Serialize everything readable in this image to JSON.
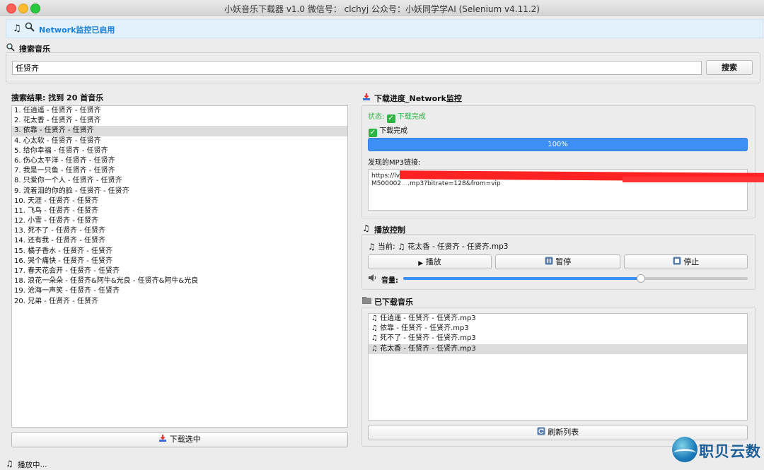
{
  "window": {
    "title": "小妖音乐下载器 v1.0  微信号： clchyj 公众号：小妖同学学AI (Selenium v4.11.2)"
  },
  "network_banner": {
    "text": "Network监控已启用"
  },
  "search": {
    "section_title": "搜索音乐",
    "input_value": "任贤齐",
    "button_label": "搜索"
  },
  "results": {
    "header": "搜索结果: 找到 20 首音乐",
    "items": [
      "1. 任逍遥 - 任贤齐 - 任贤齐",
      "2. 花太香 - 任贤齐 - 任贤齐",
      "3. 依靠 - 任贤齐 - 任贤齐",
      "4. 心太软 - 任贤齐 - 任贤齐",
      "5. 给你幸福 - 任贤齐 - 任贤齐",
      "6. 伤心太平洋 - 任贤齐 - 任贤齐",
      "7. 我是一只鱼 - 任贤齐 - 任贤齐",
      "8. 只爱你一个人 - 任贤齐 - 任贤齐",
      "9. 流着泪的你的脸 - 任贤齐 - 任贤齐",
      "10. 天涯 - 任贤齐 - 任贤齐",
      "11. 飞鸟 - 任贤齐 - 任贤齐",
      "12. 小雪 - 任贤齐 - 任贤齐",
      "13. 死不了 - 任贤齐 - 任贤齐",
      "14. 还有我 - 任贤齐 - 任贤齐",
      "15. 橘子香水 - 任贤齐 - 任贤齐",
      "16. 哭个痛快 - 任贤齐 - 任贤齐",
      "17. 春天花会开 - 任贤齐 - 任贤齐",
      "18. 浪花一朵朵 - 任贤齐&阿牛&光良 - 任贤齐&阿牛&光良",
      "19. 沧海一声笑 - 任贤齐 - 任贤齐",
      "20. 兄弟 - 任贤齐 - 任贤齐"
    ],
    "selected_index": 2,
    "download_button": "下载选中"
  },
  "progress": {
    "section_title": "下载进度_Network监控",
    "status_label": "状态:",
    "status_value": "下载完成",
    "message": "下载完成",
    "percent": 100,
    "percent_text": "100%",
    "links_label": "发现的MP3链接:",
    "link_line1": "https://lv",
    "link_line2": "M500002",
    "link_line2_tail": ".mp3?bitrate=128&from=vip"
  },
  "player": {
    "section_title": "播放控制",
    "current_label": "当前:",
    "current_track": "花太香 - 任贤齐 - 任贤齐.mp3",
    "play_label": "播放",
    "pause_label": "暂停",
    "stop_label": "停止",
    "volume_label": "音量:",
    "volume_level": 0.69
  },
  "downloaded": {
    "section_title": "已下载音乐",
    "items": [
      "任逍遥 - 任贤齐 - 任贤齐.mp3",
      "依靠 - 任贤齐 - 任贤齐.mp3",
      "死不了 - 任贤齐 - 任贤齐.mp3",
      "花太香 - 任贤齐 - 任贤齐.mp3"
    ],
    "selected_index": 3,
    "refresh_label": "刷新列表"
  },
  "statusbar": {
    "text": "播放中..."
  },
  "watermark": {
    "text": "职贝云数"
  },
  "colors": {
    "accent": "#3d8ff5",
    "status_green": "#2fb344",
    "banner_text": "#1a7fd8",
    "redaction": "#ff2222"
  },
  "icons": {
    "banner": [
      "music-note-icon",
      "search-icon"
    ],
    "search_section": "magnifier-icon",
    "progress_section": "download-icon",
    "player_section": "music-note-icon",
    "downloaded_section": "folder-icon"
  }
}
